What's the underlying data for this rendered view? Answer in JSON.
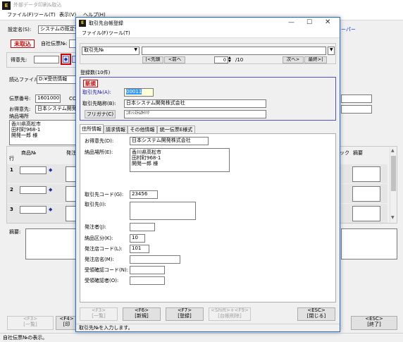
{
  "main": {
    "title": "外部データ印刷&取込",
    "menu": [
      "ファイル(F)",
      "ツール(T)",
      "表示(V)",
      "ヘルプ(H)"
    ],
    "settings_label": "設定名(S):",
    "settings_value": "システムの既定値",
    "status_badge": "未取込",
    "company_slip_label": "自社伝票№:",
    "client_label": "得意先:",
    "read_file_label": "読込ファイル名:",
    "read_file_value": "D:¥受信情報",
    "slip_no_label": "伝票番号:",
    "slip_no_value": "16010001",
    "co_label": "CO",
    "customer_label": "お得意先:",
    "customer_value": "日本システム開発株",
    "delivery_label": "納品場所",
    "delivery_lines": [
      "香川県高松市",
      "田村町968-1",
      "開発一郎 様"
    ],
    "header_row": "行",
    "col_product": "商品№",
    "col_order": "発注",
    "col_lock": "ック",
    "col_memo": "摘要",
    "rows": [
      "1",
      "2",
      "3"
    ],
    "memo_label": "摘要:",
    "right_link": "ーパー",
    "bottom_buttons": [
      {
        "key": "<F3>",
        "label": "[一覧]"
      },
      {
        "key": "<F4>",
        "label": "[印"
      },
      {
        "key": "<ESC>",
        "label": "[終了]"
      }
    ],
    "status": "自社伝票№の表示。"
  },
  "dialog": {
    "title": "取引先台帳登録",
    "menu": [
      "ファイル(F)",
      "ツール(T)"
    ],
    "combo_value": "取引先№",
    "nav_buttons": [
      "|<先頭",
      "<前へ",
      "次へ>",
      "最終>|"
    ],
    "page_value": "0",
    "page_total": "/10",
    "reg_count": "登録数(10件)",
    "new_badge": "新規",
    "client_no_label": "取引先№(A):",
    "client_no_value": "00011",
    "short_name_label": "取引先略称(B):",
    "short_name_value": "日本システム開発株式会社",
    "kana_label": "フリガナ(C)",
    "kana_value": "ﾆﾎﾝｼｽﾃﾑｶｲﾊﾂ",
    "tabs": [
      "住所情報",
      "請求情報",
      "その他情報",
      "統一伝票E様式"
    ],
    "customer_label": "お得意先(D):",
    "customer_value": "日本システム開発株式会社",
    "delivery_label": "納品場所(E):",
    "delivery_lines": [
      "香川県高松市",
      "田村町968-1",
      "開発一郎 様"
    ],
    "client_code_label": "取引先コード(G):",
    "client_code_value": "23456",
    "client_label": "取引先(I):",
    "orderer_label": "発注者(J):",
    "delivery_div_label": "納品区分(K):",
    "delivery_div_value": "10",
    "order_store_code_label": "発注店コード(L):",
    "order_store_code_value": "101",
    "order_store_name_label": "発注店名(M):",
    "recv_code_label": "受領確認コード(N):",
    "recv_person_label": "受領確認者(O):",
    "footer_buttons": [
      {
        "key": "<F3>",
        "label": "[一覧]",
        "enabled": false
      },
      {
        "key": "<F6>",
        "label": "[新規]",
        "enabled": true
      },
      {
        "key": "<F7>",
        "label": "[登録]",
        "enabled": true
      },
      {
        "key": "<Shift>+<F9>",
        "label": "[台帳削除]",
        "enabled": false
      },
      {
        "key": "<ESC>",
        "label": "[閉じる]",
        "enabled": true
      }
    ],
    "status": "取引先№を入力します。"
  },
  "colors": {
    "accent_red": "#cc0000",
    "focus_highlight": "#3399ff",
    "nav_blue": "#2020c0",
    "new_box_border": "#5050c8"
  }
}
